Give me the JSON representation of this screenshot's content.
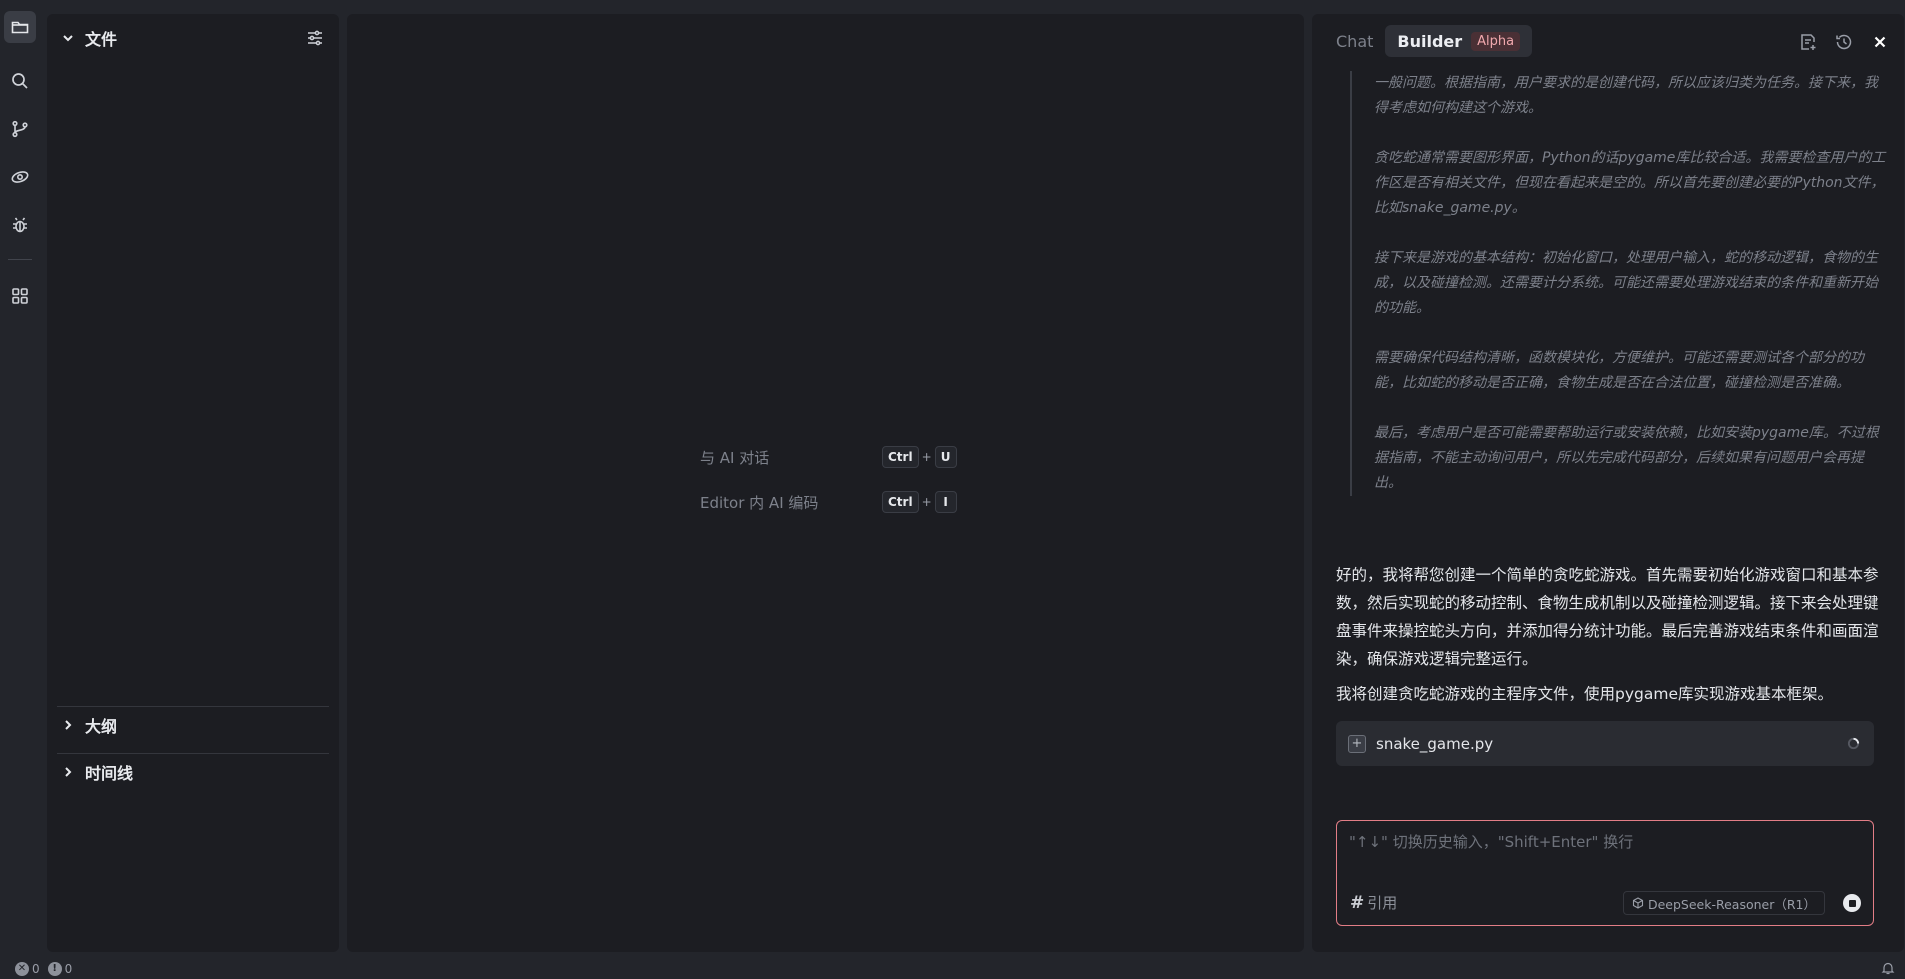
{
  "activity_bar": {
    "items": [
      "files-icon",
      "search-icon",
      "source-control-icon",
      "ai-agent-icon",
      "debug-icon",
      "extensions-icon"
    ]
  },
  "explorer": {
    "title": "文件",
    "sections": [
      "大纲",
      "时间线"
    ]
  },
  "editor": {
    "hints": [
      {
        "label": "与 AI 对话",
        "keys": [
          "Ctrl",
          "U"
        ]
      },
      {
        "label": "Editor 内 AI 编码",
        "keys": [
          "Ctrl",
          "I"
        ]
      }
    ]
  },
  "panel": {
    "tabs": {
      "chat": "Chat",
      "builder": "Builder",
      "alpha_badge": "Alpha"
    },
    "thinking": [
      "一般问题。根据指南，用户要求的是创建代码，所以应该归类为任务。接下来，我得考虑如何构建这个游戏。",
      "贪吃蛇通常需要图形界面，Python的话pygame库比较合适。我需要检查用户的工作区是否有相关文件，但现在看起来是空的。所以首先要创建必要的Python文件，比如snake_game.py。",
      "接下来是游戏的基本结构：初始化窗口，处理用户输入，蛇的移动逻辑，食物的生成，以及碰撞检测。还需要计分系统。可能还需要处理游戏结束的条件和重新开始的功能。",
      "需要确保代码结构清晰，函数模块化，方便维护。可能还需要测试各个部分的功能，比如蛇的移动是否正确，食物生成是否在合法位置，碰撞检测是否准确。",
      "最后，考虑用户是否可能需要帮助运行或安装依赖，比如安装pygame库。不过根据指南，不能主动询问用户，所以先完成代码部分，后续如果有问题用户会再提出。"
    ],
    "answer": "好的，我将帮您创建一个简单的贪吃蛇游戏。首先需要初始化游戏窗口和基本参数，然后实现蛇的移动控制、食物生成机制以及碰撞检测逻辑。接下来会处理键盘事件来操控蛇头方向，并添加得分统计功能。最后完善游戏结束条件和画面渲染，确保游戏逻辑完整运行。",
    "answer2": "我将创建贪吃蛇游戏的主程序文件，使用pygame库实现游戏基本框架。",
    "file": {
      "name": "snake_game.py",
      "icon": "+"
    },
    "input": {
      "placeholder": "\"↑↓\" 切换历史输入，\"Shift+Enter\" 换行",
      "cite_hash": "#",
      "cite_label": "引用",
      "model": "DeepSeek-Reasoner（R1）"
    }
  },
  "status_bar": {
    "errors": "0",
    "warnings": "0"
  },
  "colors": {
    "accent": "#e27d86",
    "alpha_badge": "#f0a8ad"
  }
}
